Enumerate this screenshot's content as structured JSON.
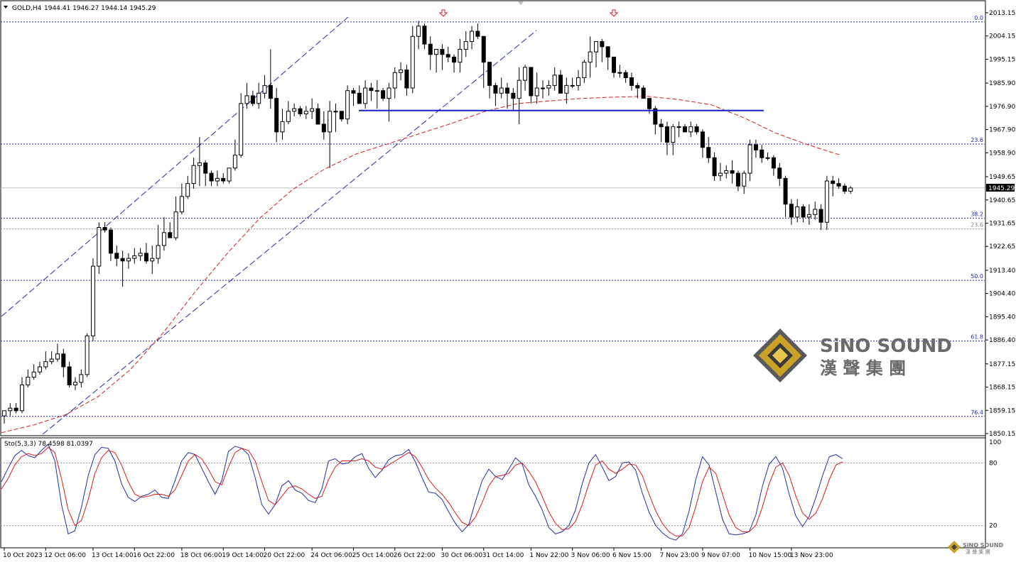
{
  "header": {
    "symbol_label": "GOLD,H4",
    "ohlc": "1944.41 1946.27 1944.14 1945.29"
  },
  "stoch_header": "Sto(5,3,3) 78.4598 81.0397",
  "current_price": "1945.29",
  "watermark": {
    "en": "SiNO SOUND",
    "zh": "漢 聲 集 團"
  },
  "colors": {
    "bull_fill": "#ffffff",
    "bear_fill": "#000000",
    "fib_line": "#1f2fa6",
    "ma_line": "#d81b1b",
    "stoch_main": "#1f2fa6",
    "stoch_signal": "#d81b1b",
    "neckline": "#1020c8",
    "arrow": "#d81b1b"
  },
  "chart_data": [
    {
      "type": "candlestick",
      "title": "GOLD,H4",
      "ylim": [
        1848.0,
        2017.0
      ],
      "y_ticks": [
        "2013.15",
        "2004.15",
        "1995.15",
        "1985.90",
        "1976.90",
        "1967.90",
        "1958.90",
        "1949.65",
        "1940.65",
        "1931.65",
        "1922.65",
        "1913.40",
        "1904.40",
        "1895.40",
        "1886.40",
        "1877.15",
        "1868.15",
        "1859.15",
        "1850.15"
      ],
      "x_ticks": [
        "10 Oct 2023",
        "12 Oct 06:00",
        "13 Oct 14:00",
        "16 Oct 22:00",
        "18 Oct 06:00",
        "19 Oct 14:00",
        "20 Oct 22:00",
        "24 Oct 06:00",
        "25 Oct 14:00",
        "26 Oct 22:00",
        "30 Oct 06:00",
        "31 Oct 14:00",
        "1 Nov 22:00",
        "3 Nov 06:00",
        "6 Nov 15:00",
        "7 Nov 23:00",
        "9 Nov 07:00",
        "10 Nov 15:00",
        "13 Nov 23:00"
      ],
      "fibonacci_levels": [
        {
          "label": "0.0",
          "price": 2009.6
        },
        {
          "label": "23.6",
          "price": 1962.3
        },
        {
          "label": "38.2",
          "price": 1933.6
        },
        {
          "label": "23.6",
          "price": 1929.4
        },
        {
          "label": "50.0",
          "price": 1909.5
        },
        {
          "label": "61.8",
          "price": 1886.0
        },
        {
          "label": "76.4",
          "price": 1856.8
        }
      ],
      "neckline_price": 1975.3,
      "moving_average": [
        1850.5,
        1853.5,
        1857.5,
        1864.5,
        1875,
        1889,
        1905,
        1920,
        1933.5,
        1944.5,
        1952.5,
        1958.5,
        1962.5,
        1966.5,
        1970.5,
        1975,
        1978,
        1979,
        1980,
        1980.5,
        1980.8,
        1979.5,
        1977.5,
        1972.5,
        1966.5,
        1962,
        1958
      ],
      "series": [
        {
          "name": "GOLD,H4",
          "open": [
            1857,
            1859,
            1860,
            1859,
            1869,
            1872,
            1874,
            1876,
            1878,
            1879,
            1881,
            1876,
            1869,
            1870,
            1873,
            1888,
            1915,
            1930,
            1929,
            1920,
            1918,
            1917,
            1918,
            1919,
            1920,
            1917,
            1918,
            1923,
            1928,
            1926,
            1936,
            1942,
            1947,
            1954,
            1955,
            1951,
            1948,
            1949,
            1948,
            1953,
            1958,
            1978,
            1981,
            1978,
            1982,
            1985,
            1980,
            1967,
            1971,
            1975,
            1976,
            1974,
            1975,
            1976,
            1970,
            1967,
            1975,
            1975,
            1972,
            1983,
            1982,
            1978,
            1984,
            1983,
            1983,
            1980,
            1984,
            1990,
            1991,
            1984,
            2004,
            2008,
            2001,
            1997,
            1999,
            1997,
            1996,
            1994,
            1999,
            2002,
            2006,
            2004,
            1994,
            1985,
            1982,
            1984,
            1982,
            1980,
            1987,
            1992,
            1981,
            1984,
            1984,
            1985,
            1989,
            1982,
            1985,
            1985,
            1988,
            1994,
            1998,
            2002,
            2000,
            1996,
            1990,
            1990,
            1988,
            1985,
            1984,
            1980,
            1976,
            1970,
            1969,
            1963,
            1969,
            1969,
            1967,
            1969,
            1967,
            1961,
            1957,
            1950,
            1951,
            1952,
            1951,
            1946,
            1951,
            1962,
            1960,
            1957,
            1957,
            1953,
            1949,
            1939,
            1934,
            1938,
            1934,
            1935,
            1937,
            1932,
            1948,
            1947,
            1946,
            1944
          ],
          "high": [
            1859,
            1862,
            1862,
            1872,
            1875,
            1877,
            1878,
            1882,
            1882,
            1885,
            1883,
            1878,
            1872,
            1875,
            1889,
            1918,
            1932,
            1932,
            1930,
            1923,
            1921,
            1920,
            1922,
            1922,
            1924,
            1923,
            1931,
            1934,
            1932,
            1942,
            1947,
            1950,
            1957,
            1965,
            1956,
            1952,
            1952,
            1951,
            1953,
            1964,
            1982,
            1986,
            1983,
            1986,
            1989,
            1999,
            1984,
            1976,
            1979,
            1978,
            1977,
            1977,
            1980,
            1978,
            1975,
            1979,
            1978,
            1975,
            1985,
            1984,
            1985,
            1987,
            1986,
            1987,
            1984,
            1986,
            1992,
            1994,
            1993,
            2008,
            2010,
            2009,
            2004,
            1998,
            2001,
            2000,
            1997,
            2003,
            2006,
            2008,
            2009,
            2004,
            1993,
            1986,
            1988,
            1986,
            1984,
            1992,
            1993,
            1992,
            1990,
            1987,
            1987,
            1992,
            1991,
            1988,
            1988,
            1991,
            1995,
            2004,
            2001,
            2003,
            2000,
            1992,
            1993,
            1991,
            1990,
            1986,
            1985,
            1980,
            1977,
            1972,
            1971,
            1970,
            1971,
            1970,
            1971,
            1970,
            1968,
            1965,
            1959,
            1955,
            1954,
            1956,
            1952,
            1952,
            1964,
            1964,
            1962,
            1959,
            1958,
            1955,
            1950,
            1941,
            1941,
            1939,
            1939,
            1940,
            1939,
            1950,
            1950,
            1949,
            1947,
            1946
          ],
          "low": [
            1854,
            1857,
            1858,
            1858,
            1868,
            1871,
            1873,
            1875,
            1877,
            1878,
            1872,
            1868,
            1867,
            1868,
            1872,
            1886,
            1912,
            1928,
            1917,
            1915,
            1907,
            1914,
            1916,
            1917,
            1916,
            1912,
            1916,
            1921,
            1926,
            1925,
            1935,
            1941,
            1945,
            1946,
            1946,
            1946,
            1946,
            1947,
            1947,
            1952,
            1957,
            1976,
            1977,
            1976,
            1980,
            1976,
            1963,
            1964,
            1970,
            1973,
            1973,
            1972,
            1972,
            1973,
            1964,
            1953,
            1967,
            1971,
            1970,
            1977,
            1978,
            1976,
            1979,
            1976,
            1979,
            1971,
            1980,
            1987,
            1981,
            1982,
            1999,
            1999,
            1991,
            1990,
            1991,
            1994,
            1990,
            1990,
            1996,
            1999,
            2003,
            1984,
            1980,
            1977,
            1980,
            1976,
            1975,
            1970,
            1983,
            1978,
            1978,
            1980,
            1981,
            1983,
            1982,
            1978,
            1984,
            1983,
            1986,
            1988,
            1992,
            1994,
            1991,
            1988,
            1988,
            1986,
            1983,
            1980,
            1980,
            1974,
            1966,
            1963,
            1958,
            1958,
            1965,
            1967,
            1965,
            1966,
            1957,
            1955,
            1948,
            1948,
            1949,
            1947,
            1944,
            1943,
            1948,
            1957,
            1955,
            1956,
            1950,
            1946,
            1934,
            1931,
            1932,
            1932,
            1931,
            1933,
            1929,
            1929,
            1942,
            1945,
            1943,
            1943
          ],
          "close": [
            1859,
            1860,
            1859,
            1869,
            1872,
            1874,
            1876,
            1878,
            1879,
            1881,
            1876,
            1869,
            1870,
            1873,
            1888,
            1915,
            1930,
            1929,
            1920,
            1918,
            1917,
            1918,
            1919,
            1920,
            1917,
            1918,
            1923,
            1928,
            1926,
            1936,
            1942,
            1947,
            1954,
            1955,
            1951,
            1948,
            1949,
            1948,
            1953,
            1958,
            1978,
            1981,
            1978,
            1982,
            1985,
            1980,
            1967,
            1971,
            1975,
            1976,
            1974,
            1975,
            1976,
            1970,
            1967,
            1975,
            1975,
            1972,
            1983,
            1982,
            1978,
            1984,
            1983,
            1983,
            1980,
            1984,
            1990,
            1991,
            1984,
            2004,
            2008,
            2001,
            1997,
            1999,
            1997,
            1996,
            1994,
            1999,
            2002,
            2006,
            2004,
            1994,
            1985,
            1982,
            1984,
            1982,
            1980,
            1987,
            1992,
            1981,
            1984,
            1984,
            1985,
            1989,
            1982,
            1985,
            1985,
            1988,
            1994,
            1998,
            2002,
            2000,
            1996,
            1990,
            1990,
            1988,
            1985,
            1984,
            1980,
            1976,
            1970,
            1969,
            1963,
            1969,
            1969,
            1967,
            1969,
            1967,
            1961,
            1957,
            1950,
            1951,
            1952,
            1951,
            1946,
            1951,
            1962,
            1960,
            1957,
            1957,
            1953,
            1949,
            1939,
            1934,
            1938,
            1934,
            1935,
            1937,
            1932,
            1948,
            1947,
            1946,
            1944,
            1945.29
          ]
        }
      ]
    },
    {
      "type": "line",
      "title": "Sto(5,3,3) 78.4598 81.0397",
      "ylim": [
        0,
        100
      ],
      "y_ticks": [
        "100",
        "80",
        "20"
      ],
      "levels": [
        80,
        20
      ],
      "series": [
        {
          "name": "main",
          "values": [
            62,
            75,
            87,
            92,
            87,
            85,
            92,
            98,
            82,
            40,
            12,
            15,
            38,
            68,
            88,
            95,
            94,
            82,
            60,
            47,
            43,
            48,
            50,
            54,
            47,
            46,
            63,
            82,
            90,
            88,
            75,
            62,
            50,
            63,
            91,
            96,
            94,
            88,
            66,
            40,
            31,
            40,
            58,
            63,
            54,
            51,
            44,
            42,
            55,
            82,
            84,
            79,
            80,
            86,
            89,
            75,
            66,
            73,
            83,
            87,
            88,
            93,
            81,
            66,
            52,
            51,
            45,
            33,
            22,
            14,
            21,
            43,
            63,
            74,
            67,
            64,
            74,
            85,
            79,
            59,
            48,
            35,
            18,
            12,
            14,
            20,
            35,
            60,
            80,
            88,
            76,
            63,
            67,
            80,
            81,
            73,
            51,
            33,
            20,
            13,
            8,
            6,
            12,
            34,
            64,
            86,
            78,
            52,
            26,
            12,
            11,
            12,
            14,
            30,
            58,
            79,
            86,
            75,
            50,
            29,
            19,
            29,
            47,
            68,
            86,
            88,
            84
          ],
          "color_key": "stoch_main"
        },
        {
          "name": "signal",
          "values": [
            55,
            65,
            78,
            86,
            89,
            87,
            89,
            95,
            90,
            65,
            35,
            20,
            25,
            45,
            70,
            85,
            92,
            90,
            78,
            62,
            50,
            47,
            48,
            50,
            50,
            48,
            54,
            68,
            82,
            88,
            84,
            74,
            62,
            59,
            76,
            90,
            94,
            92,
            82,
            62,
            44,
            40,
            48,
            56,
            58,
            55,
            50,
            46,
            48,
            64,
            76,
            82,
            82,
            82,
            84,
            82,
            76,
            74,
            78,
            82,
            86,
            90,
            86,
            76,
            64,
            56,
            50,
            42,
            32,
            23,
            20,
            28,
            42,
            58,
            67,
            68,
            70,
            78,
            80,
            72,
            62,
            48,
            33,
            22,
            16,
            17,
            24,
            40,
            60,
            78,
            82,
            74,
            70,
            74,
            79,
            78,
            68,
            50,
            34,
            22,
            14,
            10,
            10,
            18,
            38,
            62,
            76,
            70,
            50,
            30,
            18,
            14,
            14,
            20,
            38,
            60,
            76,
            80,
            68,
            48,
            32,
            26,
            32,
            46,
            64,
            78,
            81
          ],
          "color_key": "stoch_signal"
        }
      ]
    }
  ]
}
